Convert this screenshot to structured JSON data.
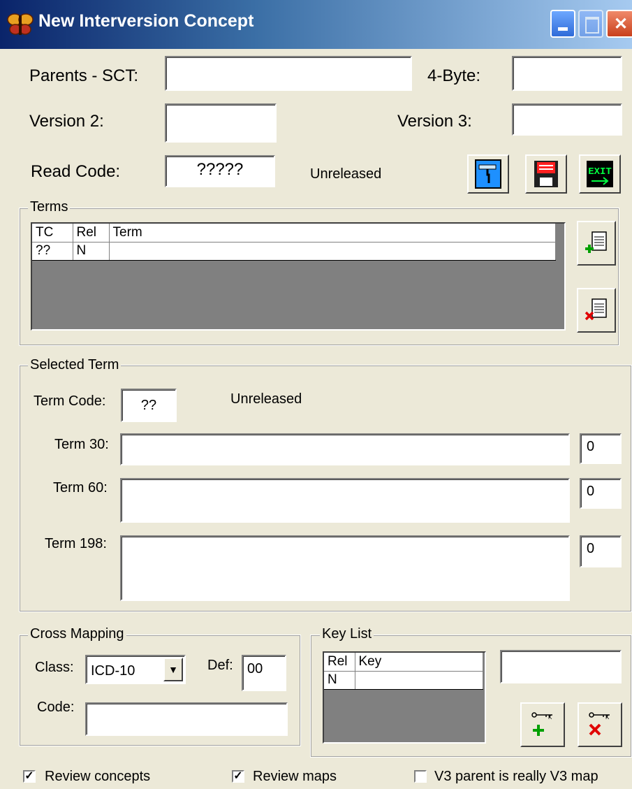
{
  "window": {
    "title": "New Interversion Concept",
    "icon": "butterfly-app-icon",
    "controls": [
      "minimize-icon",
      "maximize-icon",
      "close-icon"
    ]
  },
  "header": {
    "parents_sct_label": "Parents - SCT:",
    "parents_sct_value": "",
    "four_byte_label": "4-Byte:",
    "four_byte_value": "",
    "version2_label": "Version 2:",
    "version2_value": "",
    "version3_label": "Version 3:",
    "version3_value": "",
    "read_code_label": "Read Code:",
    "read_code_value": "?????",
    "status": "Unreleased"
  },
  "toolbar": {
    "buttons": [
      {
        "name": "clear-button",
        "icon": "paint-roller-icon"
      },
      {
        "name": "save-button",
        "icon": "floppy-disk-icon"
      },
      {
        "name": "exit-button",
        "icon": "exit-icon",
        "text": "EXIT"
      }
    ]
  },
  "terms": {
    "legend": "Terms",
    "columns": [
      "TC",
      "Rel",
      "Term"
    ],
    "rows": [
      [
        "??",
        "N",
        ""
      ]
    ],
    "add_icon": "add-term-icon",
    "delete_icon": "delete-term-icon"
  },
  "selected_term": {
    "legend": "Selected Term",
    "term_code_label": "Term Code:",
    "term_code_value": "??",
    "status": "Unreleased",
    "term30_label": "Term 30:",
    "term30_value": "",
    "term30_count": "0",
    "term60_label": "Term 60:",
    "term60_value": "",
    "term60_count": "0",
    "term198_label": "Term 198:",
    "term198_value": "",
    "term198_count": "0"
  },
  "cross_mapping": {
    "legend": "Cross Mapping",
    "class_label": "Class:",
    "class_value": "ICD-10",
    "def_label": "Def:",
    "def_value": "00",
    "code_label": "Code:",
    "code_value": ""
  },
  "key_list": {
    "legend": "Key List",
    "columns": [
      "Rel",
      "Key"
    ],
    "rows": [
      [
        "N",
        ""
      ]
    ],
    "key_input": "",
    "add_key_icon": "add-key-icon",
    "delete_key_icon": "delete-key-icon"
  },
  "footer": {
    "review_concepts_label": "Review concepts",
    "review_concepts_checked": true,
    "review_maps_label": "Review maps",
    "review_maps_checked": true,
    "v3_parent_label": "V3 parent is really V3 map",
    "v3_parent_checked": false
  },
  "colors": {
    "dialog_bg": "#ece9d8",
    "titlebar": "#0a246a",
    "grid_bg": "#808080",
    "add_green": "#00a000",
    "delete_red": "#e00000"
  }
}
